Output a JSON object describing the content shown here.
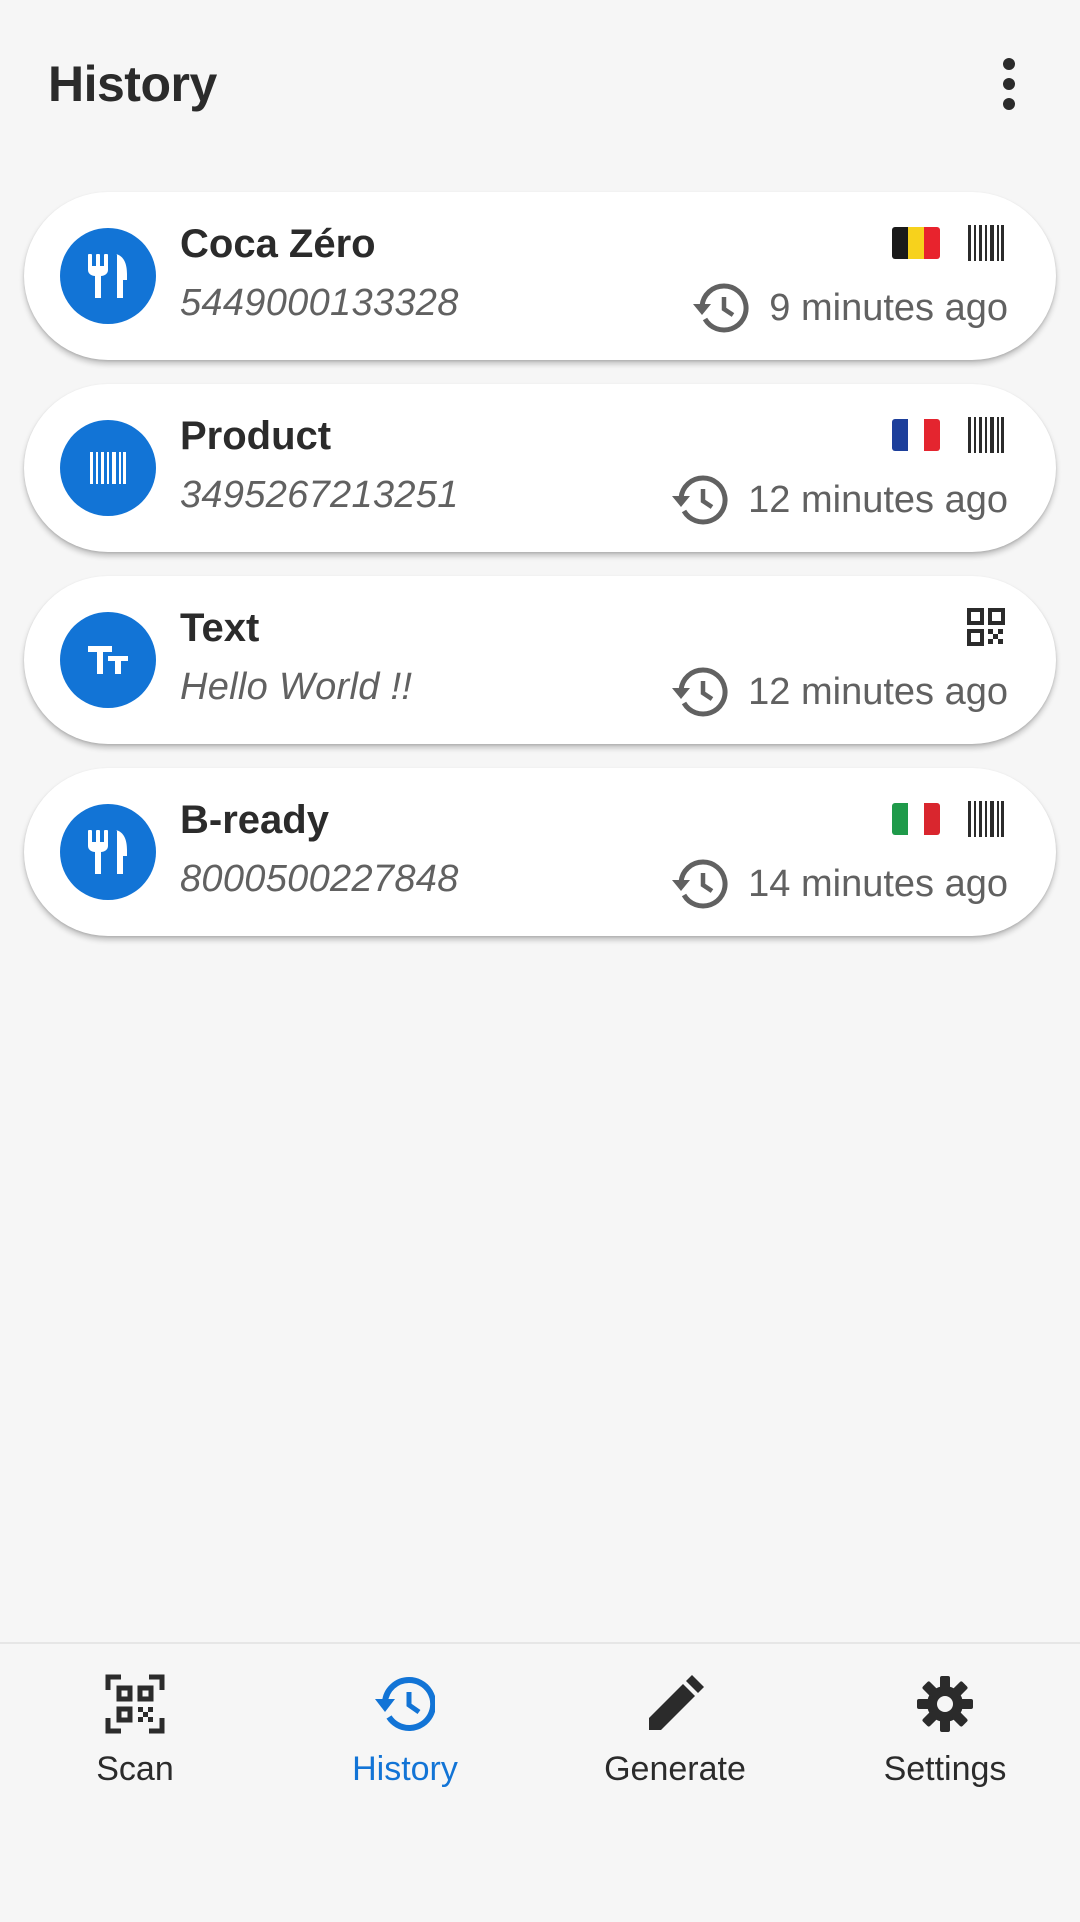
{
  "header": {
    "title": "History",
    "menu_icon": "more-vert-icon"
  },
  "colors": {
    "accent": "#1274d6",
    "background": "#f6f6f6",
    "card": "#ffffff",
    "text_primary": "#2b2b2b",
    "text_secondary": "#616161"
  },
  "history_items": [
    {
      "title": "Coca Zéro",
      "value": "5449000133328",
      "time": "9 minutes ago",
      "category_icon": "restaurant-icon",
      "country_flag": "belgium-flag",
      "format_icon": "barcode-icon"
    },
    {
      "title": "Product",
      "value": "3495267213251",
      "time": "12 minutes ago",
      "category_icon": "barcode-icon",
      "country_flag": "france-flag",
      "format_icon": "barcode-icon"
    },
    {
      "title": "Text",
      "value": "Hello World !!",
      "time": "12 minutes ago",
      "category_icon": "text-fields-icon",
      "format_icon": "qr-code-icon"
    },
    {
      "title": "B-ready",
      "value": "8000500227848",
      "time": "14 minutes ago",
      "category_icon": "restaurant-icon",
      "country_flag": "italy-flag",
      "format_icon": "barcode-icon"
    }
  ],
  "bottom_nav": {
    "items": [
      {
        "label": "Scan",
        "icon": "qr-scanner-icon",
        "active": false
      },
      {
        "label": "History",
        "icon": "history-icon",
        "active": true
      },
      {
        "label": "Generate",
        "icon": "pencil-icon",
        "active": false
      },
      {
        "label": "Settings",
        "icon": "gear-icon",
        "active": false
      }
    ]
  }
}
